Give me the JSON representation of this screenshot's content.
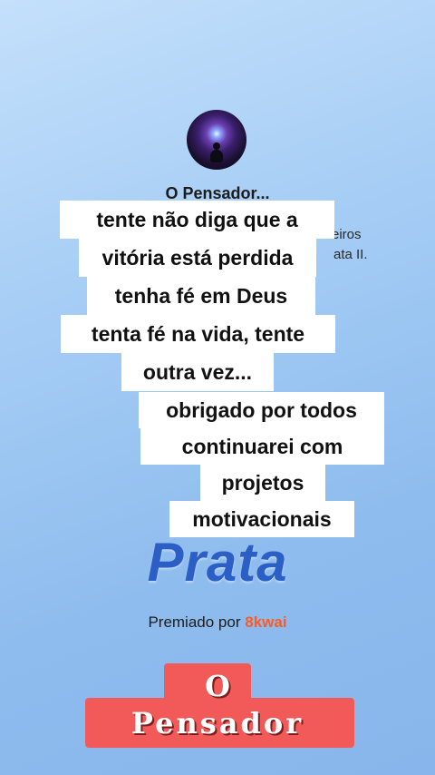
{
  "profile": {
    "username": "O Pensador...",
    "background_line_1": "eiros",
    "background_line_2": "ata II."
  },
  "caption_1": {
    "lines": [
      "tente não diga que a",
      "vitória está perdida",
      "tenha fé em Deus",
      "tenta fé na vida, tente",
      "outra vez..."
    ]
  },
  "caption_2": {
    "lines": [
      "obrigado por todos",
      "continuarei com",
      "projetos",
      "motivacionais"
    ]
  },
  "award": {
    "tier": "Prata",
    "text": "Premiado por",
    "brand_icon": "8",
    "brand": "kwai"
  },
  "logo": {
    "line_1": "O",
    "line_2": "Pensador"
  },
  "colors": {
    "accent": "#2c5fc6",
    "logo_bg": "#f15a58",
    "kwai": "#ff5a1f"
  }
}
